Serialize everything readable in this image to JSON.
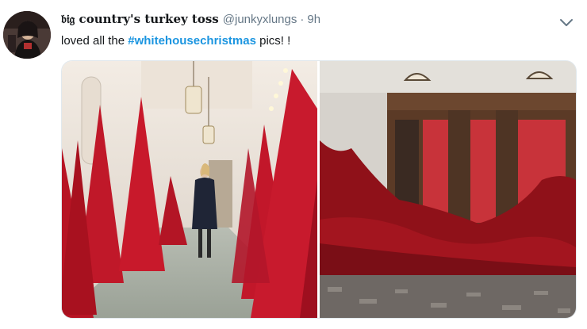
{
  "tweet": {
    "display_name": "𝔟𝔦𝔤 country's turkey toss",
    "handle": "@junkyxlungs",
    "separator": "·",
    "time": "9h",
    "text_before": "loved all the ",
    "hashtag": "#whitehousechristmas",
    "text_after": " pics! !",
    "hashtag_color": "#1b95e0"
  },
  "icons": {
    "avatar": "user-avatar",
    "menu": "chevron-down-icon"
  },
  "media": {
    "images": [
      "hallway-red-trees-photo",
      "blood-elevator-photo"
    ]
  }
}
